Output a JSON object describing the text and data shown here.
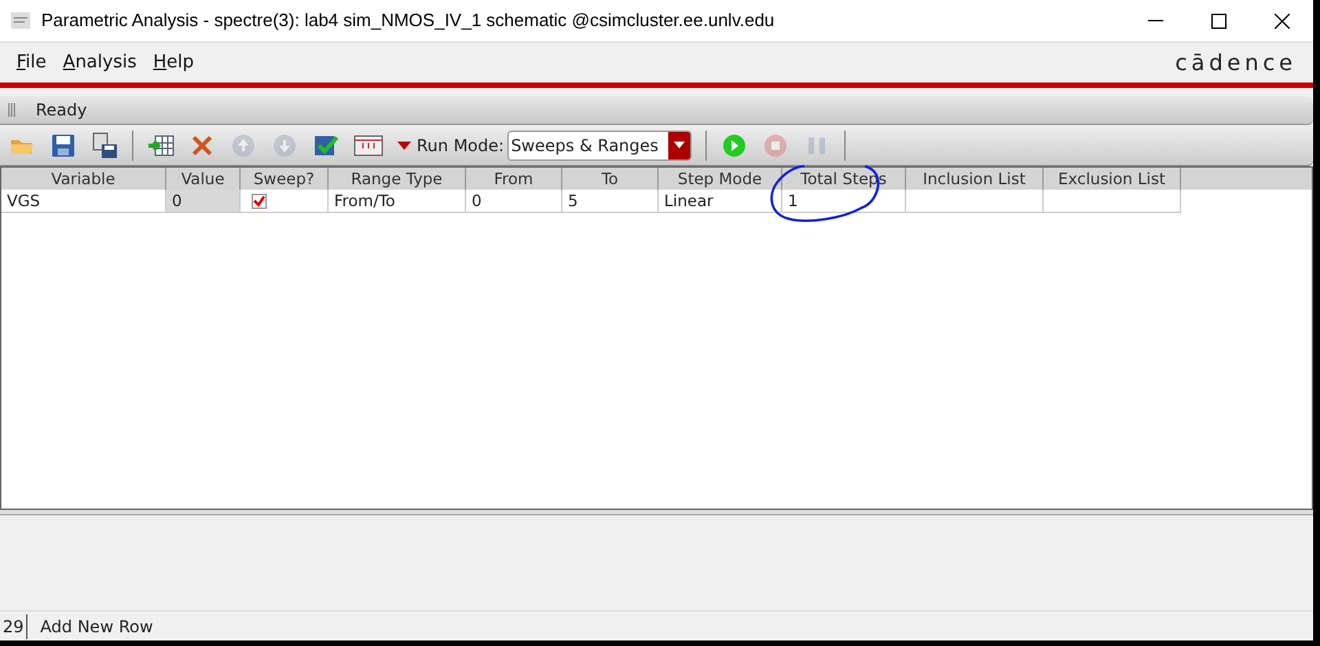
{
  "window": {
    "title": "Parametric Analysis - spectre(3): lab4 sim_NMOS_IV_1 schematic @csimcluster.ee.unlv.edu"
  },
  "menu": [
    {
      "label": "File"
    },
    {
      "label": "Analysis"
    },
    {
      "label": "Help"
    }
  ],
  "logo": "cādence",
  "status": "Ready",
  "toolbar": [
    {
      "kind": "open",
      "disabled": false
    },
    {
      "kind": "save",
      "disabled": false
    },
    {
      "kind": "save-as",
      "disabled": false
    },
    {
      "kind": "sep"
    },
    {
      "kind": "add-row",
      "disabled": false
    },
    {
      "kind": "delete",
      "disabled": false
    },
    {
      "kind": "up",
      "disabled": true
    },
    {
      "kind": "down",
      "disabled": true
    },
    {
      "kind": "check",
      "disabled": false
    },
    {
      "kind": "table",
      "disabled": false
    },
    {
      "kind": "dropdown",
      "disabled": false
    },
    {
      "kind": "runmode",
      "label": "Run Mode:",
      "value": "Sweeps & Ranges"
    },
    {
      "kind": "sep"
    },
    {
      "kind": "run",
      "disabled": false
    },
    {
      "kind": "stop",
      "disabled": true
    },
    {
      "kind": "pause",
      "disabled": true
    },
    {
      "kind": "sep"
    }
  ],
  "table": {
    "columns": [
      "Variable",
      "Value",
      "Sweep?",
      "Range Type",
      "From",
      "To",
      "Step Mode",
      "Total Steps",
      "Inclusion List",
      "Exclusion List"
    ],
    "rows": [
      {
        "cells": [
          "VGS",
          "0",
          "",
          "From/To",
          "0",
          "5",
          "Linear",
          "1",
          "",
          ""
        ],
        "sweep_checked": true
      }
    ]
  },
  "annotation": {
    "kind": "circle"
  },
  "status_bar": {
    "count": "29",
    "message": "Add New Row"
  }
}
